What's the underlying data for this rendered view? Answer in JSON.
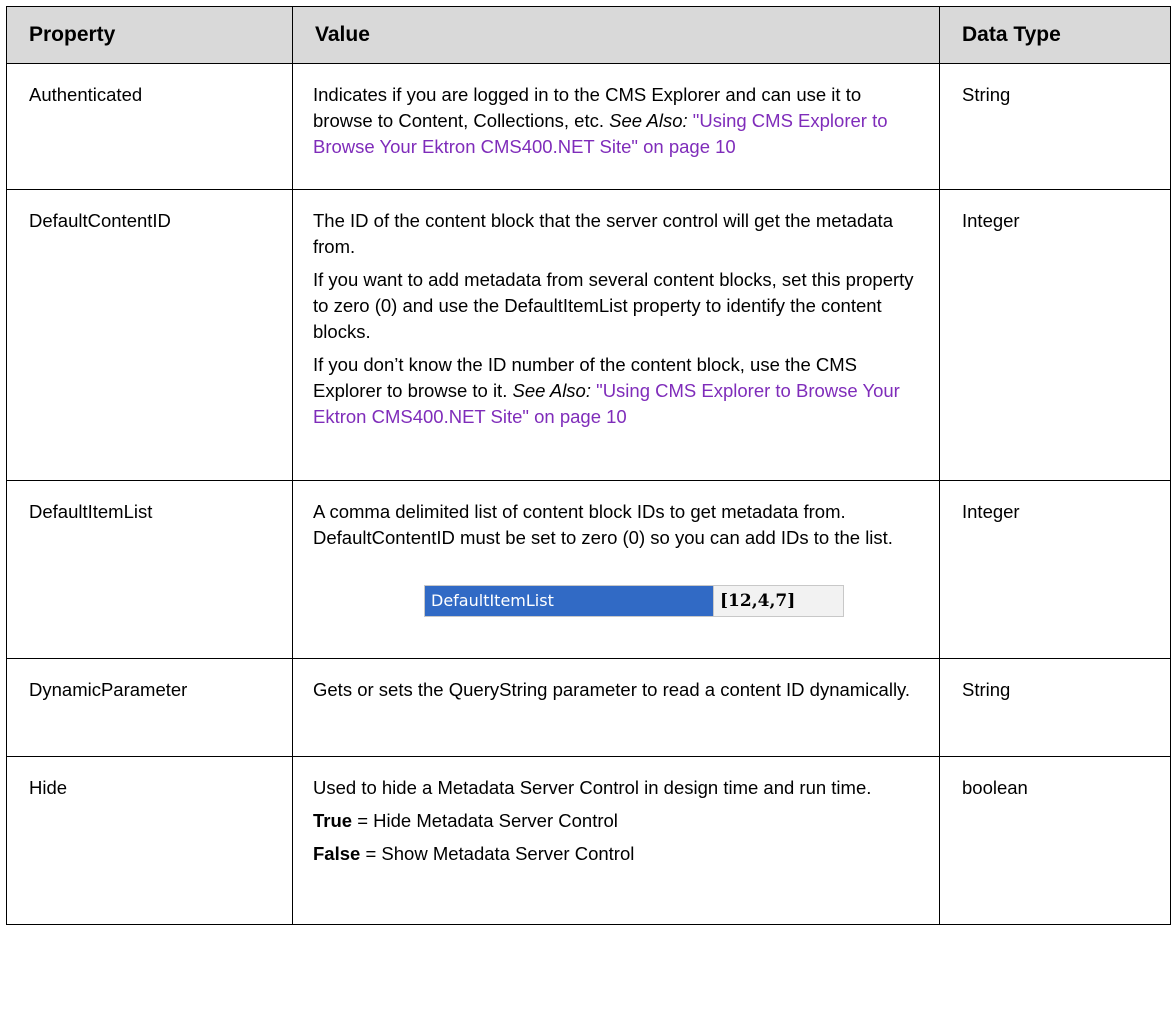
{
  "table": {
    "headers": {
      "property": "Property",
      "value": "Value",
      "data_type": "Data Type"
    },
    "rows": [
      {
        "property": "Authenticated",
        "data_type": "String",
        "p1_text": "Indicates if you are logged in to the CMS Explorer and can use it to browse to Content, Collections, etc. ",
        "p1_italic": "See Also:",
        "p1_link": " \"Using CMS Explorer to Browse Your Ektron CMS400.NET Site\" on page 10"
      },
      {
        "property": "DefaultContentID",
        "data_type": "Integer",
        "p1": "The ID of the content block that the server control will get the metadata from.",
        "p2": "If you want to add metadata from several content blocks, set this property to zero (0) and use the DefaultItemList property to identify the content blocks.",
        "p3_text": "If you don’t know the ID number of the content block, use the CMS Explorer to browse to it. ",
        "p3_italic": "See Also:",
        "p3_link": " \"Using CMS Explorer to Browse Your Ektron CMS400.NET Site\" on page 10"
      },
      {
        "property": "DefaultItemList",
        "data_type": "Integer",
        "p1": "A comma delimited list of content block IDs to get metadata from. DefaultContentID must be set to zero (0) so you can add IDs to the list.",
        "snippet_name": "DefaultItemList",
        "snippet_value": "[12,4,7]"
      },
      {
        "property": "DynamicParameter",
        "data_type": "String",
        "p1": "Gets or sets the QueryString parameter to read a content ID dynamically."
      },
      {
        "property": "Hide",
        "data_type": "boolean",
        "p1": "Used to hide a Metadata Server Control in design time and run time.",
        "p2_bold": "True",
        "p2_text": " = Hide Metadata Server Control",
        "p3_bold": "False",
        "p3_text": " = Show Metadata Server Control"
      }
    ]
  },
  "colors": {
    "header_bg": "#d9d9d9",
    "link": "#7f2cba",
    "border": "#000000",
    "snippet_name_bg": "#316ac5"
  }
}
